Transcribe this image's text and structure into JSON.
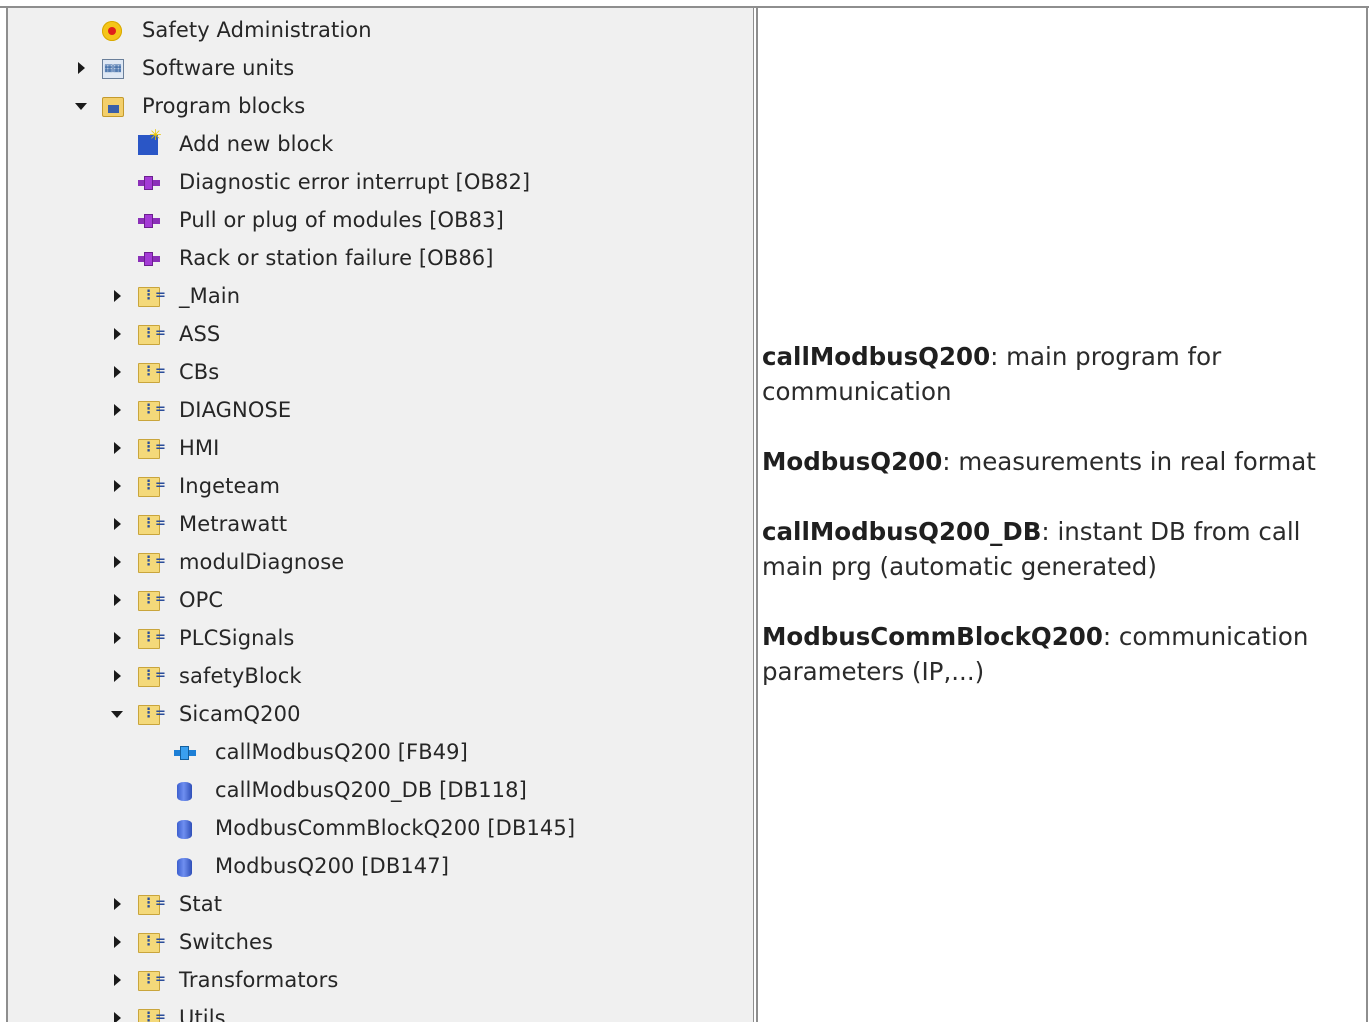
{
  "tree": {
    "items": [
      {
        "label": "Safety Administration",
        "icon": "safety-icon",
        "indent": 0,
        "expand": "none"
      },
      {
        "label": "Software units",
        "icon": "software-units-icon",
        "indent": 0,
        "expand": "collapsed"
      },
      {
        "label": "Program blocks",
        "icon": "program-blocks-icon",
        "indent": 0,
        "expand": "expanded"
      },
      {
        "label": "Add new block",
        "icon": "add-block-icon",
        "indent": 1,
        "expand": "none"
      },
      {
        "label": "Diagnostic error interrupt [OB82]",
        "icon": "organization-block-icon",
        "indent": 1,
        "expand": "none"
      },
      {
        "label": "Pull or plug of modules [OB83]",
        "icon": "organization-block-icon",
        "indent": 1,
        "expand": "none"
      },
      {
        "label": "Rack or station failure [OB86]",
        "icon": "organization-block-icon",
        "indent": 1,
        "expand": "none"
      },
      {
        "label": "_Main",
        "icon": "folder-icon",
        "indent": 1,
        "expand": "collapsed"
      },
      {
        "label": "ASS",
        "icon": "folder-icon",
        "indent": 1,
        "expand": "collapsed"
      },
      {
        "label": "CBs",
        "icon": "folder-icon",
        "indent": 1,
        "expand": "collapsed"
      },
      {
        "label": "DIAGNOSE",
        "icon": "folder-icon",
        "indent": 1,
        "expand": "collapsed"
      },
      {
        "label": "HMI",
        "icon": "folder-icon",
        "indent": 1,
        "expand": "collapsed"
      },
      {
        "label": "Ingeteam",
        "icon": "folder-icon",
        "indent": 1,
        "expand": "collapsed"
      },
      {
        "label": "Metrawatt",
        "icon": "folder-icon",
        "indent": 1,
        "expand": "collapsed"
      },
      {
        "label": "modulDiagnose",
        "icon": "folder-icon",
        "indent": 1,
        "expand": "collapsed"
      },
      {
        "label": "OPC",
        "icon": "folder-icon",
        "indent": 1,
        "expand": "collapsed"
      },
      {
        "label": "PLCSignals",
        "icon": "folder-icon",
        "indent": 1,
        "expand": "collapsed"
      },
      {
        "label": "safetyBlock",
        "icon": "folder-icon",
        "indent": 1,
        "expand": "collapsed"
      },
      {
        "label": "SicamQ200",
        "icon": "folder-icon",
        "indent": 1,
        "expand": "expanded"
      },
      {
        "label": "callModbusQ200 [FB49]",
        "icon": "function-block-icon",
        "indent": 2,
        "expand": "none"
      },
      {
        "label": "callModbusQ200_DB [DB118]",
        "icon": "data-block-icon",
        "indent": 2,
        "expand": "none"
      },
      {
        "label": "ModbusCommBlockQ200 [DB145]",
        "icon": "data-block-icon",
        "indent": 2,
        "expand": "none"
      },
      {
        "label": "ModbusQ200 [DB147]",
        "icon": "data-block-icon",
        "indent": 2,
        "expand": "none"
      },
      {
        "label": "Stat",
        "icon": "folder-icon",
        "indent": 1,
        "expand": "collapsed"
      },
      {
        "label": "Switches",
        "icon": "folder-icon",
        "indent": 1,
        "expand": "collapsed"
      },
      {
        "label": "Transformators",
        "icon": "folder-icon",
        "indent": 1,
        "expand": "collapsed"
      },
      {
        "label": "Utils",
        "icon": "folder-icon",
        "indent": 1,
        "expand": "collapsed"
      }
    ]
  },
  "descriptions": [
    {
      "term": "callModbusQ200",
      "text": ": main program for communication"
    },
    {
      "term": "ModbusQ200",
      "text": ": measurements in real format"
    },
    {
      "term": "callModbusQ200_DB",
      "text": ": instant DB from call main prg (automatic generated)"
    },
    {
      "term": "ModbusCommBlockQ200",
      "text": ": communication parameters (IP,...)"
    }
  ]
}
